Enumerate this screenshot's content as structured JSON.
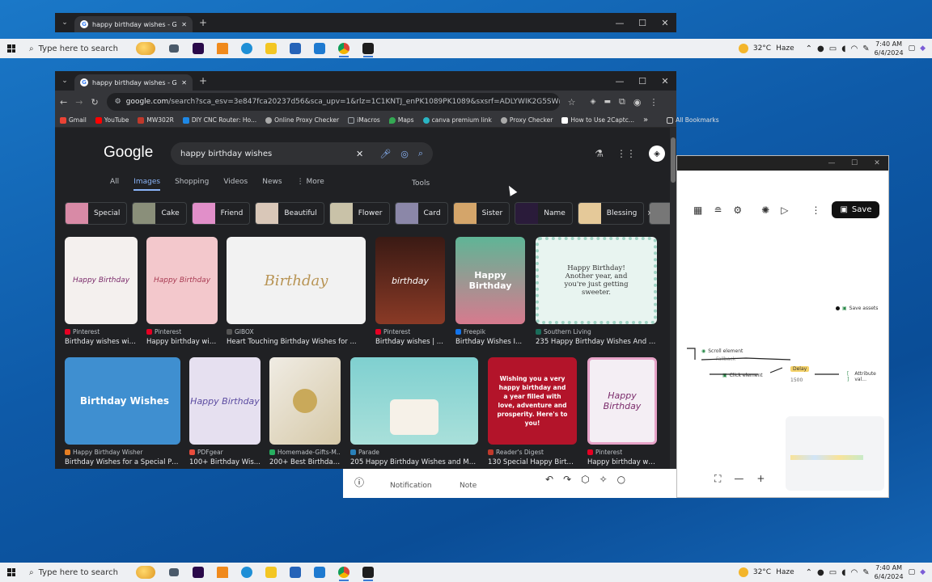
{
  "background_window": {
    "tab_title": "happy birthday wishes - Google"
  },
  "taskbar": {
    "search_placeholder": "Type here to search",
    "weather": "32°C",
    "weather_desc": "Haze",
    "time": "7:40 AM",
    "date": "6/4/2024",
    "apps": [
      {
        "name": "task-view-icon",
        "color": "#4a5a6a"
      },
      {
        "name": "premiere-icon",
        "color": "#2a0a4a"
      },
      {
        "name": "vlc-icon",
        "color": "#f08a1c"
      },
      {
        "name": "edge-icon",
        "color": "#1e8fd6"
      },
      {
        "name": "file-explorer-icon",
        "color": "#f3c623"
      },
      {
        "name": "store-icon",
        "color": "#2563b8"
      },
      {
        "name": "mail-icon",
        "color": "#1e7ad0"
      },
      {
        "name": "chrome-icon",
        "color": "#db4437"
      },
      {
        "name": "app-icon",
        "color": "#1e1e1e"
      }
    ]
  },
  "browser": {
    "tab_title": "happy birthday wishes - Google",
    "url_host": "google.com",
    "url_rest": "/search?sca_esv=3e847fca20237d56&sca_upv=1&rlz=1C1KNTJ_enPK1089PK1089&sxsrf=ADLYWIK2G5SWmqDmzH2CtxWltvpZ...",
    "bookmarks": [
      {
        "label": "Gmail",
        "color": "#ea4335"
      },
      {
        "label": "YouTube",
        "color": "#ff0000"
      },
      {
        "label": "MW302R",
        "color": "#c0392b"
      },
      {
        "label": "DIY CNC Router: Ho...",
        "color": "#1e88e5"
      },
      {
        "label": "Online Proxy Checker",
        "color": "#aaaaaa"
      },
      {
        "label": "iMacros",
        "color": "#9aa0a6"
      },
      {
        "label": "Maps",
        "color": "#34a853"
      },
      {
        "label": "canva premium link",
        "color": "#2ab5c4"
      },
      {
        "label": "Proxy Checker",
        "color": "#aaaaaa"
      },
      {
        "label": "How to Use 2Captc...",
        "color": "#ffffff"
      }
    ],
    "more_bookmarks": "»",
    "all_bookmarks": "All Bookmarks"
  },
  "google": {
    "logo": "Google",
    "query": "happy birthday wishes",
    "tabs": [
      "All",
      "Images",
      "Shopping",
      "Videos",
      "News",
      "More"
    ],
    "active_tab": "Images",
    "tools": "Tools",
    "chips": [
      {
        "label": "Special",
        "color": "#d88aa6"
      },
      {
        "label": "Cake",
        "color": "#8a8f7a"
      },
      {
        "label": "Friend",
        "color": "#e18fc9"
      },
      {
        "label": "Beautiful",
        "color": "#d9c7b8"
      },
      {
        "label": "Flower",
        "color": "#c9c2a8"
      },
      {
        "label": "Card",
        "color": "#8b87a8"
      },
      {
        "label": "Sister",
        "color": "#d4a56a"
      },
      {
        "label": "Name",
        "color": "#2a1b3a"
      },
      {
        "label": "Blessing",
        "color": "#e5c999"
      },
      {
        "label": "",
        "color": "#777777"
      }
    ],
    "results_row1": [
      {
        "source": "Pinterest",
        "title": "Birthday wishes wit...",
        "bg": "#f4f0ee",
        "src_color": "#e60023",
        "img_text": "Happy Birthday"
      },
      {
        "source": "Pinterest",
        "title": "Happy birthday wis...",
        "bg": "#f3c8cc",
        "src_color": "#e60023",
        "img_text": "Happy Birthday"
      },
      {
        "source": "GIBOX",
        "title": "Heart Touching Birthday Wishes for ...",
        "bg": "#f2f2f2",
        "src_color": "#555555",
        "img_text": "Birthday"
      },
      {
        "source": "Pinterest",
        "title": "Birthday wishes | ...",
        "bg": "#5a2a1c",
        "src_color": "#e60023",
        "img_text": "birthday"
      },
      {
        "source": "Freepik",
        "title": "Birthday Wishes I...",
        "bg": "#6fb8a0",
        "src_color": "#1273eb",
        "img_text": "Happy Birthday"
      },
      {
        "source": "Southern Living",
        "title": "235 Happy Birthday Wishes And M...",
        "bg": "#e8f4f0",
        "src_color": "#1a6d5a",
        "img_text": "Happy Birthday! Another year, and you're just getting sweeter."
      }
    ],
    "results_row2": [
      {
        "source": "Happy Birthday Wisher",
        "title": "Birthday Wishes for a Special Pe...",
        "bg": "#3f8fd0",
        "src_color": "#e67e22",
        "img_text": "Birthday Wishes"
      },
      {
        "source": "PDFgear",
        "title": "100+ Birthday Wis...",
        "bg": "#e6e0f0",
        "src_color": "#e74c3c",
        "img_text": "Happy Birthday"
      },
      {
        "source": "Homemade-Gifts-M...",
        "title": "200+ Best Birthday...",
        "bg": "#e8e2d8",
        "src_color": "#27ae60",
        "img_text": ""
      },
      {
        "source": "Parade",
        "title": "205 Happy Birthday Wishes and Mes...",
        "bg": "#7fd0d0",
        "src_color": "#2980b9",
        "img_text": ""
      },
      {
        "source": "Reader's Digest",
        "title": "130 Special Happy Birth...",
        "bg": "#b3142a",
        "src_color": "#c0392b",
        "img_text": "Wishing you a very happy birthday and a year filled with love, adventure and prosperity. Here's to you!"
      },
      {
        "source": "Pinterest",
        "title": "Happy birthday wis...",
        "bg": "#f4eef4",
        "src_color": "#e60023",
        "img_text": "Happy Birthday"
      }
    ]
  },
  "editor": {
    "save_label": "Save",
    "nodes": [
      "Save assets",
      "Scroll element",
      "Fallback",
      "Click element",
      "Delay",
      "1500",
      "Attribute val..."
    ]
  },
  "bottom_panel": {
    "items": [
      "Notification",
      "Note"
    ]
  }
}
